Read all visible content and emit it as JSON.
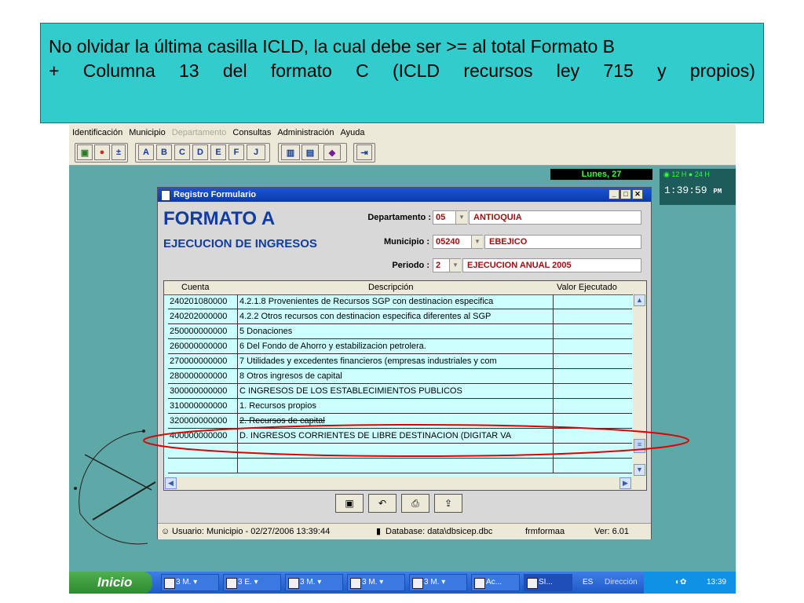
{
  "note": {
    "line1": "No olvidar la última casilla ICLD, la cual debe ser >= al total Formato B",
    "line2_parts": [
      "+",
      "Columna",
      "13",
      "del",
      "formato",
      "C",
      "(ICLD",
      "recursos",
      "ley",
      "715",
      "y",
      "propios)"
    ]
  },
  "menu": {
    "items": [
      "Identificación",
      "Municipio",
      "Departamento",
      "Consultas",
      "Administración",
      "Ayuda"
    ],
    "disabled_index": 2
  },
  "toolbar": {
    "letters": [
      "A",
      "B",
      "C",
      "D",
      "E",
      "F",
      "J"
    ]
  },
  "datebar": {
    "date": "Lunes, 27"
  },
  "clock": {
    "opt12": "12 H",
    "opt24": "24 H",
    "time": "1:39:59",
    "ampm": "PM"
  },
  "dialog": {
    "title": "Registro Formulario",
    "heading": "FORMATO A",
    "subheading": "EJECUCION DE INGRESOS",
    "fields": {
      "departamento": {
        "label": "Departamento :",
        "code": "05",
        "name": "ANTIOQUIA"
      },
      "municipio": {
        "label": "Municipio :",
        "code": "05240",
        "name": "EBEJICO"
      },
      "periodo": {
        "label": "Periodo :",
        "code": "2",
        "name": "EJECUCION ANUAL 2005"
      }
    },
    "grid": {
      "columns": [
        "Cuenta",
        "Descripción",
        "Valor Ejecutado"
      ],
      "rows": [
        [
          "240201080000",
          "4.2.1.8   Provenientes de Recursos SGP con destinacion especifica",
          ""
        ],
        [
          "240202000000",
          "4.2.2   Otros recursos con destinacion especifica diferentes al SGP",
          ""
        ],
        [
          "250000000000",
          "5  Donaciones",
          ""
        ],
        [
          "260000000000",
          "6  Del Fondo de Ahorro y estabilizacion petrolera.",
          ""
        ],
        [
          "270000000000",
          "7  Utilidades y excedentes financieros (empresas industriales y com",
          ""
        ],
        [
          "280000000000",
          "8  Otros ingresos de capital",
          ""
        ],
        [
          "300000000000",
          "C   INGRESOS DE LOS ESTABLECIMIENTOS PUBLICOS",
          ""
        ],
        [
          "310000000000",
          "1.   Recursos propios",
          ""
        ],
        [
          "320000000000",
          "2.   Recursos de capital",
          ""
        ],
        [
          "400000000000",
          "D. INGRESOS CORRIENTES DE LIBRE DESTINACION (DIGITAR VA",
          ""
        ]
      ]
    },
    "status": {
      "user": "Usuario: Municipio - 02/27/2006  13:39:44",
      "database": "Database: data\\dbsicep.dbc",
      "form": "frmformaa",
      "version": "Ver: 6.01"
    }
  },
  "taskbar": {
    "start": "Inicio",
    "tasks": [
      "3 M.",
      "3 E.",
      "3 M.",
      "3 M.",
      "3 M.",
      "Ac...",
      "SI..."
    ],
    "lang": "ES",
    "direccion": "Dirección",
    "time": "13:39"
  },
  "colors": {
    "note_bg": "#33cccc",
    "highlight_oval": "#e00000",
    "field_text": "#a01010",
    "heading": "#123da0"
  }
}
